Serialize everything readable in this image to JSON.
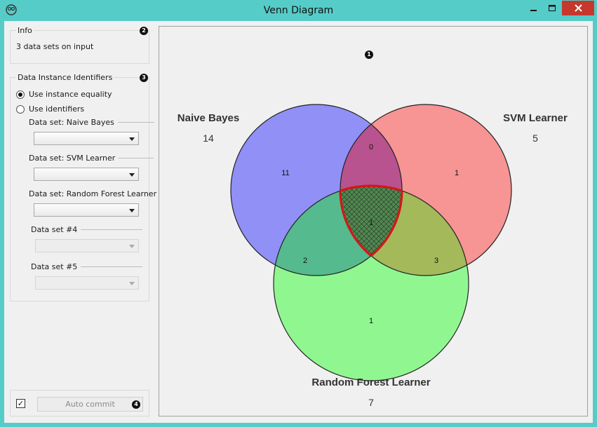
{
  "window": {
    "title": "Venn Diagram"
  },
  "info": {
    "title": "Info",
    "text": "3 data sets on input",
    "badge": "2"
  },
  "identifiers": {
    "title": "Data Instance Identifiers",
    "badge": "3",
    "option_equality": "Use instance equality",
    "option_identifiers": "Use identifiers",
    "selected": "Use instance equality",
    "datasets": [
      {
        "label": "Data set: Naive Bayes",
        "value": "",
        "enabled": true
      },
      {
        "label": "Data set: SVM Learner",
        "value": "",
        "enabled": true
      },
      {
        "label": "Data set: Random Forest Learner",
        "value": "",
        "enabled": true
      },
      {
        "label": "Data set #4",
        "value": "",
        "enabled": false
      },
      {
        "label": "Data set #5",
        "value": "",
        "enabled": false
      }
    ]
  },
  "commit": {
    "checked": true,
    "check_mark": "✓",
    "label": "Auto commit",
    "badge": "4"
  },
  "venn": {
    "badge": "1",
    "sets": [
      {
        "name": "Naive Bayes",
        "size": "14",
        "color": "#9090f7"
      },
      {
        "name": "SVM Learner",
        "size": "5",
        "color": "#f79494"
      },
      {
        "name": "Random Forest Learner",
        "size": "7",
        "color": "#90f790"
      }
    ],
    "regions": {
      "only_a": "11",
      "ab": "0",
      "only_b": "1",
      "abc": "1",
      "ac": "2",
      "bc": "3",
      "only_c": "1"
    },
    "colors": {
      "ab": "#b8538f",
      "ac": "#55ba8e",
      "bc": "#a3b95a",
      "abc": "#4f8a4f",
      "selection_outline": "#d41616"
    }
  }
}
